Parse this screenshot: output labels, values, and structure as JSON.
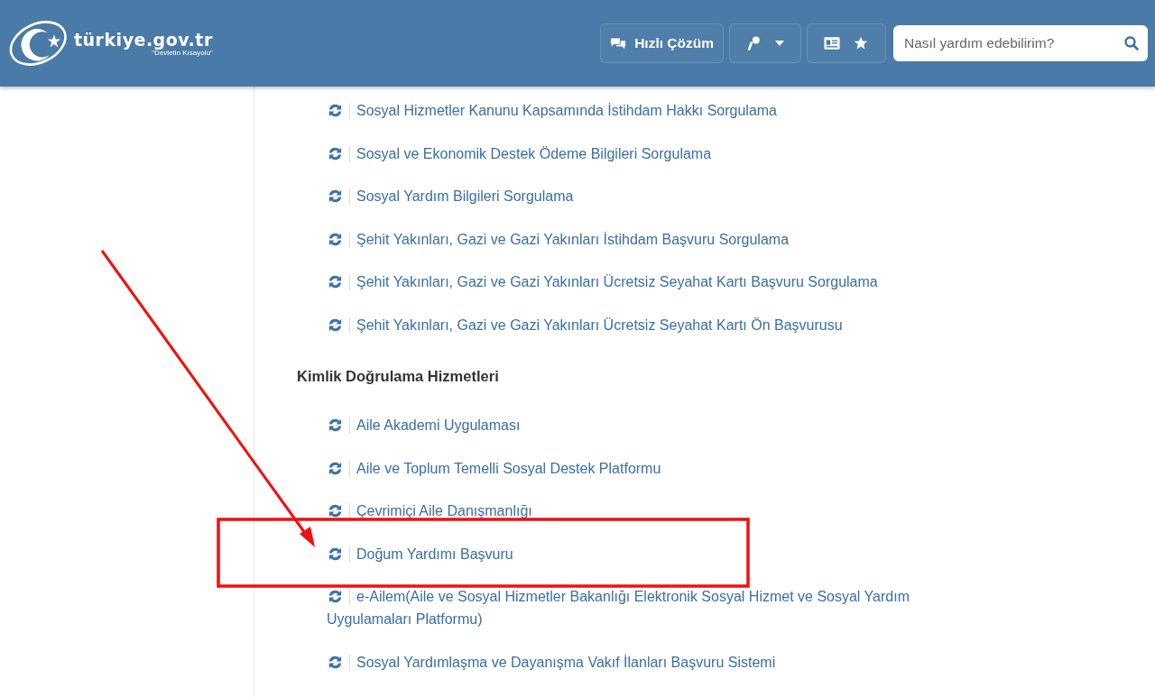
{
  "header": {
    "logo": "türkiye.gov.tr",
    "logo_tagline": "\"Devletin Kısayolu\"",
    "quick_button": "Hızlı Çözüm",
    "search": {
      "placeholder": "Nasıl yardım edebilirim?"
    }
  },
  "sections": [
    {
      "items": [
        "Sosyal Hizmetler Kanunu Kapsamında İstihdam Hakkı Sorgulama",
        "Sosyal ve Ekonomik Destek Ödeme Bilgileri Sorgulama",
        "Sosyal Yardım Bilgileri Sorgulama",
        "Şehit Yakınları, Gazi ve Gazi Yakınları İstihdam Başvuru Sorgulama",
        "Şehit Yakınları, Gazi ve Gazi Yakınları Ücretsiz Seyahat Kartı Başvuru Sorgulama",
        "Şehit Yakınları, Gazi ve Gazi Yakınları Ücretsiz Seyahat Kartı Ön Başvurusu"
      ]
    },
    {
      "title": "Kimlik Doğrulama Hizmetleri",
      "items": [
        "Aile Akademi Uygulaması",
        "Aile ve Toplum Temelli Sosyal Destek Platformu",
        "Çevrimiçi Aile Danışmanlığı",
        "Doğum Yardımı Başvuru",
        "e-Ailem(Aile ve Sosyal Hizmetler Bakanlığı Elektronik Sosyal Hizmet ve Sosyal Yardım Uygulamaları Platformu)",
        "Sosyal Yardımlaşma ve Dayanışma Vakıf İlanları Başvuru Sistemi"
      ]
    }
  ]
}
